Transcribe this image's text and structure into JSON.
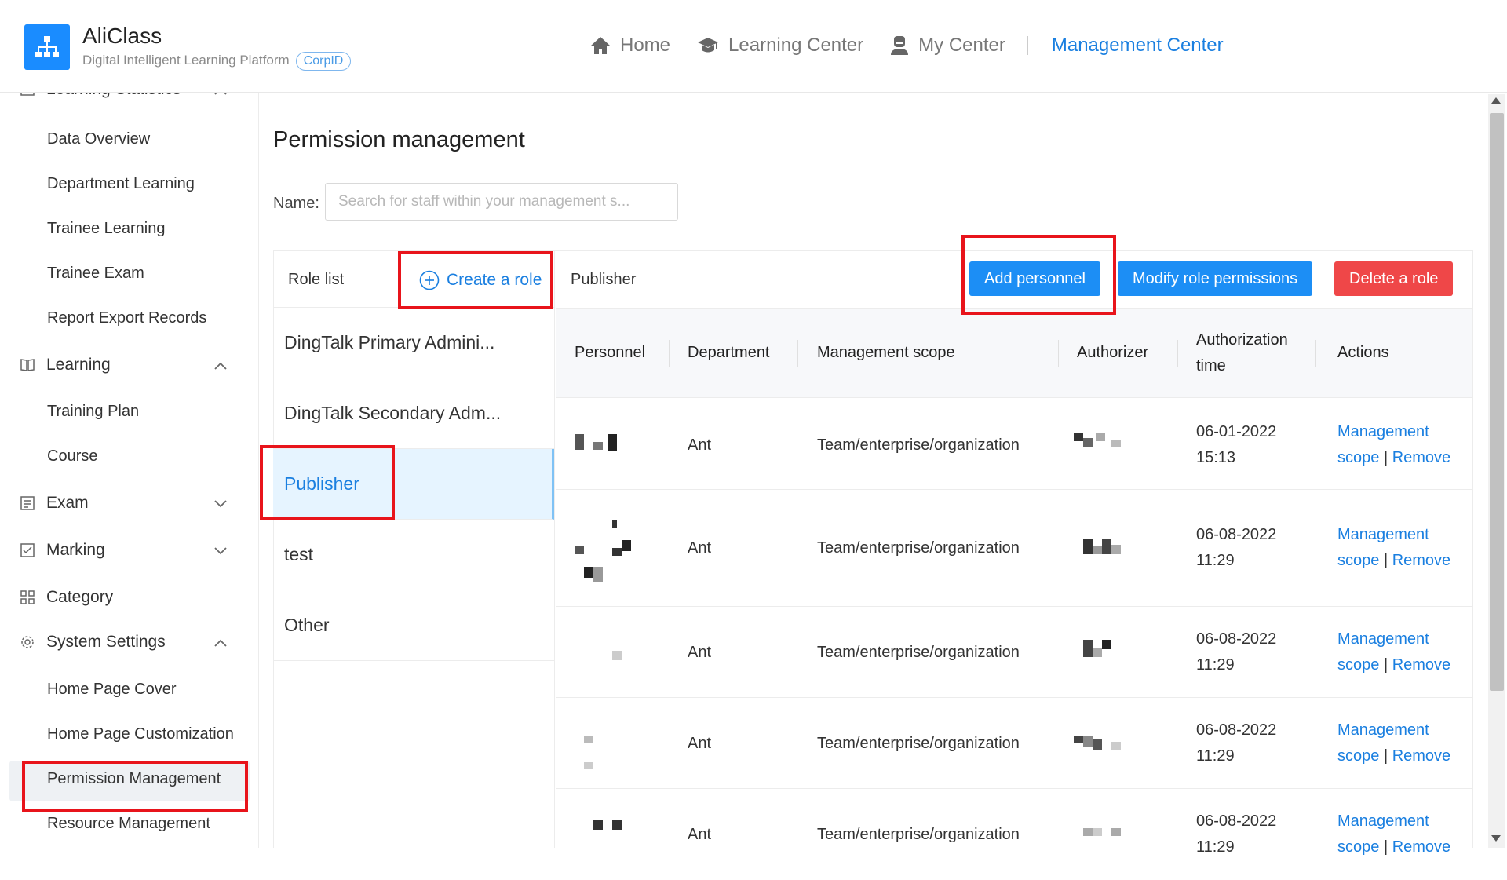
{
  "header": {
    "brand_name": "AliClass",
    "brand_subtitle": "Digital Intelligent Learning Platform",
    "corp_badge": "CorpID",
    "nav": [
      {
        "label": "Home",
        "icon": "home-icon"
      },
      {
        "label": "Learning Center",
        "icon": "graduation-cap-icon"
      },
      {
        "label": "My Center",
        "icon": "user-icon"
      },
      {
        "label": "Management Center",
        "active": true
      }
    ]
  },
  "sidebar": {
    "learning_statistics": "Learning Statistics",
    "stats_items": [
      "Data Overview",
      "Department Learning",
      "Trainee Learning",
      "Trainee Exam",
      "Report Export Records"
    ],
    "learning_group": "Learning",
    "learning_items": [
      "Training Plan",
      "Course"
    ],
    "exam_group": "Exam",
    "marking_group": "Marking",
    "category_group": "Category",
    "system_group": "System Settings",
    "system_items": [
      "Home Page Cover",
      "Home Page Customization",
      "Permission Management",
      "Resource Management"
    ]
  },
  "main": {
    "title": "Permission management",
    "name_label": "Name:",
    "name_placeholder": "Search for staff within your management s...",
    "role_list_label": "Role list",
    "create_role_label": "Create a role",
    "roles": [
      "DingTalk Primary Admini...",
      "DingTalk Secondary Adm...",
      "Publisher",
      "test",
      "Other"
    ],
    "selected_role": "Publisher",
    "detail_title": "Publisher",
    "buttons": {
      "add_personnel": "Add personnel",
      "modify_permissions": "Modify role permissions",
      "delete_role": "Delete a role"
    },
    "columns": {
      "personnel": "Personnel",
      "department": "Department",
      "scope": "Management scope",
      "authorizer": "Authorizer",
      "auth_time_1": "Authorization",
      "auth_time_2": "time",
      "actions": "Actions"
    },
    "rows": [
      {
        "department": "Ant",
        "scope": "Team/enterprise/organization",
        "date": "06-01-2022",
        "time": "15:13",
        "action1": "Management",
        "action2": "scope",
        "pipe": "|",
        "action3": "Remove"
      },
      {
        "department": "Ant",
        "scope": "Team/enterprise/organization",
        "date": "06-08-2022",
        "time": "11:29",
        "action1": "Management",
        "action2": "scope",
        "pipe": "|",
        "action3": "Remove"
      },
      {
        "department": "Ant",
        "scope": "Team/enterprise/organization",
        "date": "06-08-2022",
        "time": "11:29",
        "action1": "Management",
        "action2": "scope",
        "pipe": "|",
        "action3": "Remove"
      },
      {
        "department": "Ant",
        "scope": "Team/enterprise/organization",
        "date": "06-08-2022",
        "time": "11:29",
        "action1": "Management",
        "action2": "scope",
        "pipe": "|",
        "action3": "Remove"
      },
      {
        "department": "Ant",
        "scope": "Team/enterprise/organization",
        "date": "06-08-2022",
        "time": "11:29",
        "action1": "Management",
        "action2": "scope",
        "pipe": "|",
        "action3": "Remove"
      }
    ]
  },
  "colors": {
    "accent": "#1a7fe0",
    "primary_button": "#1c8ef5",
    "danger_button": "#ef4748",
    "highlight_box": "#e8141b"
  }
}
